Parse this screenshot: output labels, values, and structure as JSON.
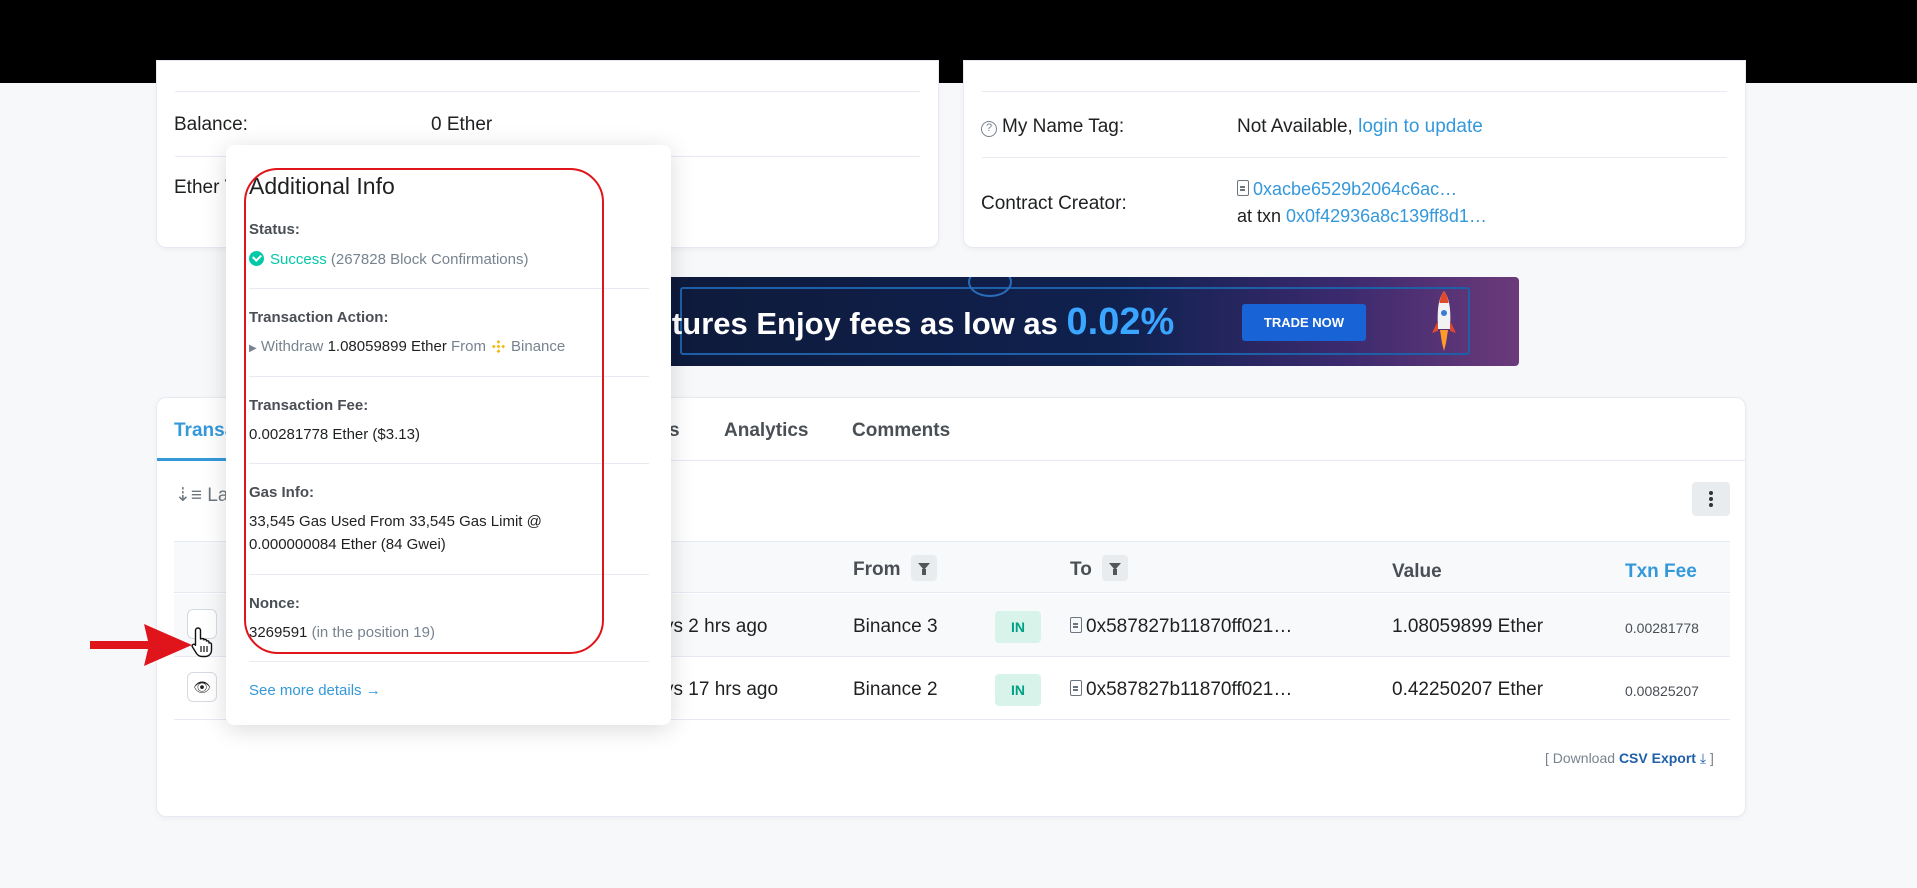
{
  "overview": {
    "balance_label": "Balance:",
    "balance_value": "0 Ether",
    "ether_value_label": "Ether V"
  },
  "more_info": {
    "name_tag_label": "My Name Tag:",
    "name_tag_value": "Not Available,",
    "name_tag_link": "login to update",
    "creator_label": "Contract Creator:",
    "creator_address": "0xacbe6529b2064c6ac…",
    "creator_txn_prefix": "at txn",
    "creator_txn": "0x0f42936a8c139ff8d1…"
  },
  "banner": {
    "text": "utures  Enjoy fees as low as",
    "percent": "0.02%",
    "button": "TRADE NOW"
  },
  "tabs": [
    {
      "label": "Transa"
    },
    {
      "label": "s"
    },
    {
      "label": "Analytics"
    },
    {
      "label": "Comments"
    }
  ],
  "sort_label": "Late",
  "table": {
    "headers": {
      "from": "From",
      "to": "To",
      "value": "Value",
      "fee": "Txn Fee"
    },
    "rows": [
      {
        "age": "ys 2 hrs ago",
        "from": "Binance 3",
        "direction": "IN",
        "to": "0x587827b11870ff021…",
        "value": "1.08059899 Ether",
        "fee": "0.00281778"
      },
      {
        "age": "ys 17 hrs ago",
        "from": "Binance 2",
        "direction": "IN",
        "to": "0x587827b11870ff021…",
        "value": "0.42250207 Ether",
        "fee": "0.00825207"
      }
    ]
  },
  "download": {
    "prefix": "[ Download",
    "link": "CSV Export",
    "suffix": "]"
  },
  "popover": {
    "title": "Additional Info",
    "status_label": "Status:",
    "status_value": "Success",
    "status_detail": "(267828 Block Confirmations)",
    "action_label": "Transaction Action:",
    "action_verb": "Withdraw",
    "action_amount": "1.08059899 Ether",
    "action_from": "From",
    "action_source": "Binance",
    "fee_label": "Transaction Fee:",
    "fee_value": "0.00281778 Ether ($3.13)",
    "gas_label": "Gas Info:",
    "gas_line1": "33,545 Gas Used From 33,545 Gas Limit @",
    "gas_line2": "0.000000084 Ether (84 Gwei)",
    "nonce_label": "Nonce:",
    "nonce_value": "3269591",
    "nonce_detail": "(in the position 19)",
    "see_more": "See more details →"
  },
  "colors": {
    "link": "#3498db",
    "success": "#00c9a7",
    "highlight": "#e0151b",
    "arrow": "#e0151b"
  }
}
